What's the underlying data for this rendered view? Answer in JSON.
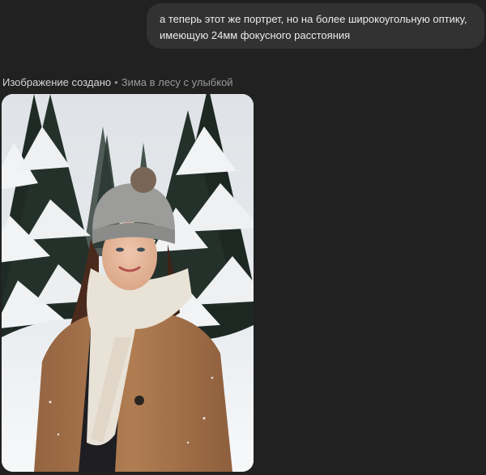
{
  "conversation": {
    "user_message": "а теперь этот же портрет, но на более широкоугольную оптику, имеющую 24мм фокусного расстояния",
    "image_status": {
      "label": "Изображение создано",
      "separator": "•",
      "title": "Зима в лесу с улыбкой"
    }
  },
  "image": {
    "palette": {
      "sky": "#e4e7ea",
      "snow": "#f1f2f4",
      "tree_dark": "#1f2a25",
      "coat": "#a8764c",
      "scarf": "#e9e2d6",
      "hat": "#9c9c9a",
      "skin": "#e2b59b",
      "hair": "#4a2a1c"
    }
  }
}
